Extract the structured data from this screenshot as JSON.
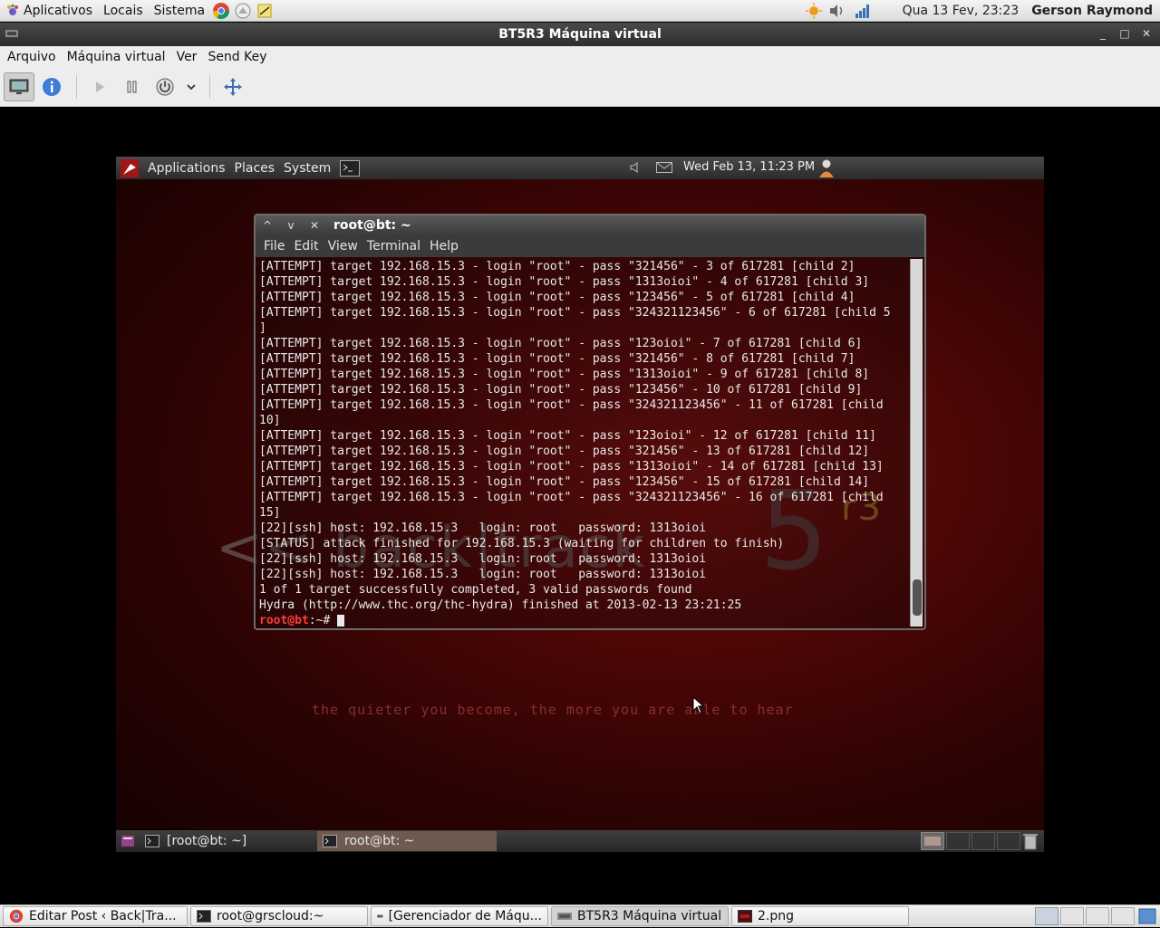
{
  "host_panel": {
    "menus": [
      "Aplicativos",
      "Locais",
      "Sistema"
    ],
    "clock": "Qua 13 Fev, 23:23",
    "user": "Gerson Raymond"
  },
  "vm_window": {
    "title": "BT5R3 Máquina virtual",
    "menus": [
      "Arquivo",
      "Máquina virtual",
      "Ver",
      "Send Key"
    ]
  },
  "guest_panel": {
    "menus": [
      "Applications",
      "Places",
      "System"
    ],
    "clock": "Wed Feb 13, 11:23 PM"
  },
  "terminal": {
    "title": "root@bt: ~",
    "menus": [
      "File",
      "Edit",
      "View",
      "Terminal",
      "Help"
    ],
    "lines": [
      "[ATTEMPT] target 192.168.15.3 - login \"root\" - pass \"321456\" - 3 of 617281 [child 2]",
      "[ATTEMPT] target 192.168.15.3 - login \"root\" - pass \"1313oioi\" - 4 of 617281 [child 3]",
      "[ATTEMPT] target 192.168.15.3 - login \"root\" - pass \"123456\" - 5 of 617281 [child 4]",
      "[ATTEMPT] target 192.168.15.3 - login \"root\" - pass \"324321123456\" - 6 of 617281 [child 5",
      "]",
      "[ATTEMPT] target 192.168.15.3 - login \"root\" - pass \"123oioi\" - 7 of 617281 [child 6]",
      "[ATTEMPT] target 192.168.15.3 - login \"root\" - pass \"321456\" - 8 of 617281 [child 7]",
      "[ATTEMPT] target 192.168.15.3 - login \"root\" - pass \"1313oioi\" - 9 of 617281 [child 8]",
      "[ATTEMPT] target 192.168.15.3 - login \"root\" - pass \"123456\" - 10 of 617281 [child 9]",
      "[ATTEMPT] target 192.168.15.3 - login \"root\" - pass \"324321123456\" - 11 of 617281 [child",
      "10]",
      "[ATTEMPT] target 192.168.15.3 - login \"root\" - pass \"123oioi\" - 12 of 617281 [child 11]",
      "[ATTEMPT] target 192.168.15.3 - login \"root\" - pass \"321456\" - 13 of 617281 [child 12]",
      "[ATTEMPT] target 192.168.15.3 - login \"root\" - pass \"1313oioi\" - 14 of 617281 [child 13]",
      "[ATTEMPT] target 192.168.15.3 - login \"root\" - pass \"123456\" - 15 of 617281 [child 14]",
      "[ATTEMPT] target 192.168.15.3 - login \"root\" - pass \"324321123456\" - 16 of 617281 [child",
      "15]",
      "[22][ssh] host: 192.168.15.3   login: root   password: 1313oioi",
      "[STATUS] attack finished for 192.168.15.3 (waiting for children to finish)",
      "[22][ssh] host: 192.168.15.3   login: root   password: 1313oioi",
      "[22][ssh] host: 192.168.15.3   login: root   password: 1313oioi",
      "1 of 1 target successfully completed, 3 valid passwords found",
      "Hydra (http://www.thc.org/thc-hydra) finished at 2013-02-13 23:21:25"
    ],
    "prompt_user": "root@bt",
    "prompt_rest": ":~# "
  },
  "wallpaper": {
    "logo": "<< back|track",
    "logo_five": "5",
    "logo_r3": "r3",
    "tagline": "the quieter you become, the more you are able to hear"
  },
  "guest_taskbar": {
    "items": [
      "[root@bt: ~]",
      "root@bt: ~"
    ]
  },
  "host_taskbar": {
    "items": [
      "Editar Post ‹ Back|Tra...",
      "root@grscloud:~",
      "[Gerenciador de Máqu...",
      "BT5R3 Máquina virtual",
      "2.png"
    ]
  }
}
